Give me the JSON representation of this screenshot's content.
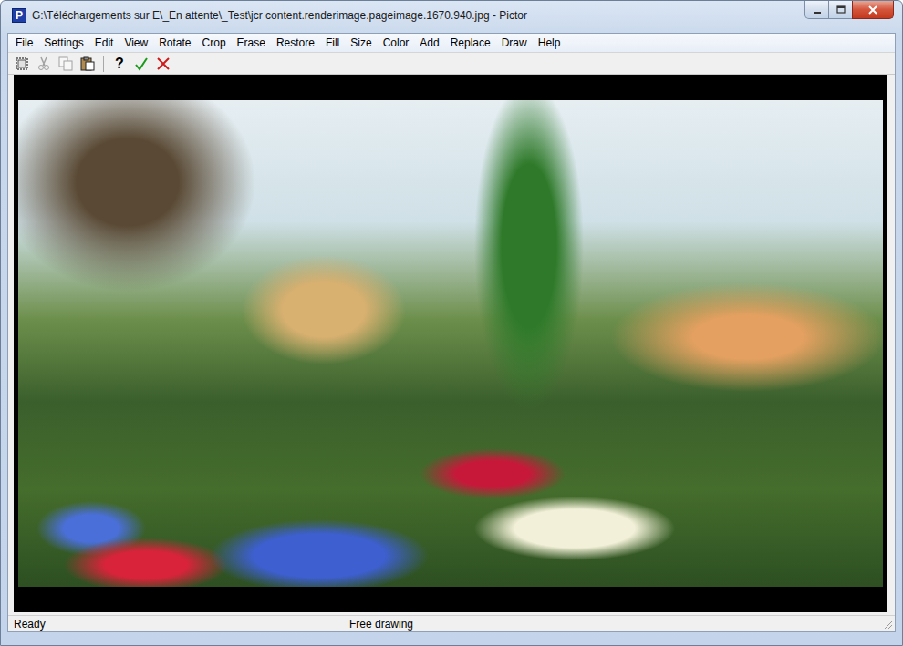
{
  "window": {
    "title": "G:\\Téléchargements sur E\\_En attente\\_Test\\jcr content.renderimage.pageimage.1670.940.jpg - Pictor",
    "app_icon": "P"
  },
  "menu": [
    "File",
    "Settings",
    "Edit",
    "View",
    "Rotate",
    "Crop",
    "Erase",
    "Restore",
    "Fill",
    "Size",
    "Color",
    "Add",
    "Replace",
    "Draw",
    "Help"
  ],
  "toolbar": {
    "groups": [
      [
        {
          "kind": "select",
          "disabled": false
        },
        {
          "kind": "cut",
          "disabled": true
        },
        {
          "kind": "copy",
          "disabled": true
        },
        {
          "kind": "paste",
          "disabled": false
        }
      ],
      [
        {
          "kind": "glyph",
          "text": "?",
          "disabled": false
        },
        {
          "kind": "accept",
          "disabled": false
        },
        {
          "kind": "cancel",
          "disabled": false
        }
      ]
    ]
  },
  "status_bar": [
    "Ready",
    "Free drawing"
  ]
}
